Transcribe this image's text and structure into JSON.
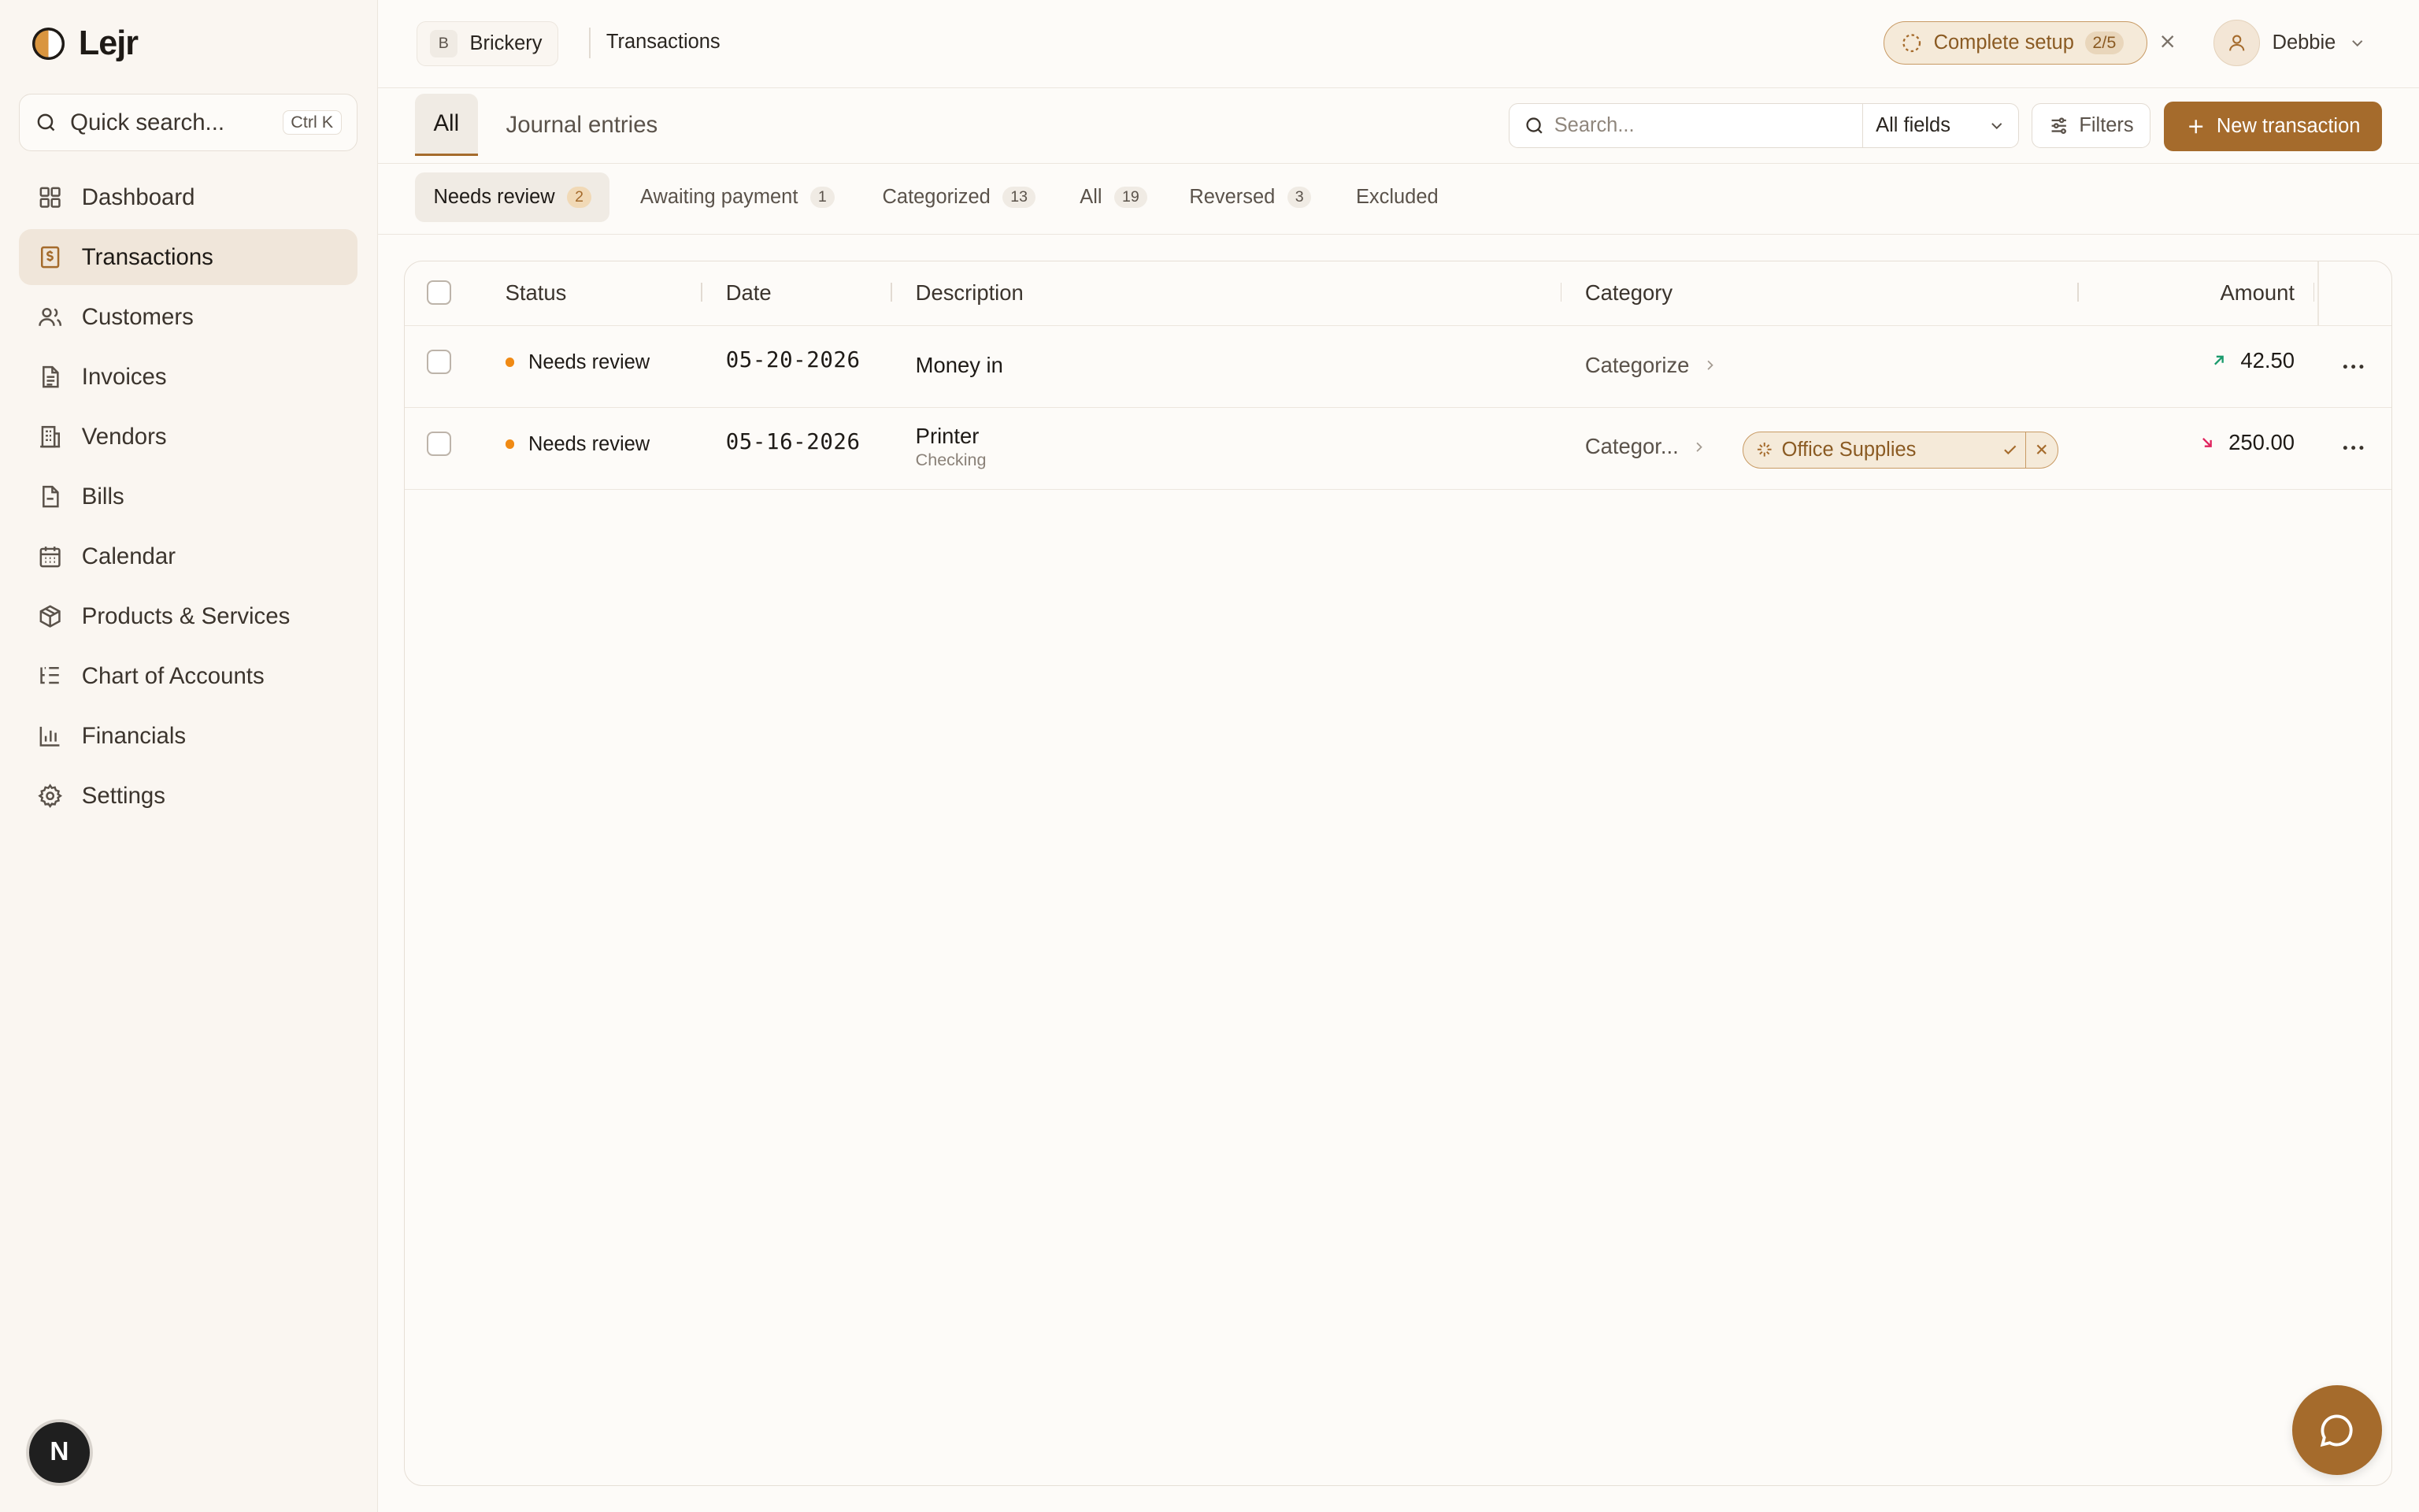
{
  "app": {
    "name": "Lejr"
  },
  "sidebar": {
    "quick_search": {
      "label": "Quick search...",
      "shortcut": "Ctrl K"
    },
    "items": [
      {
        "label": "Dashboard",
        "icon": "grid-icon",
        "active": false
      },
      {
        "label": "Transactions",
        "icon": "receipt-icon",
        "active": true
      },
      {
        "label": "Customers",
        "icon": "users-icon",
        "active": false
      },
      {
        "label": "Invoices",
        "icon": "document-icon",
        "active": false
      },
      {
        "label": "Vendors",
        "icon": "building-icon",
        "active": false
      },
      {
        "label": "Bills",
        "icon": "file-icon",
        "active": false
      },
      {
        "label": "Calendar",
        "icon": "calendar-icon",
        "active": false
      },
      {
        "label": "Products & Services",
        "icon": "box-icon",
        "active": false
      },
      {
        "label": "Chart of Accounts",
        "icon": "list-tree-icon",
        "active": false
      },
      {
        "label": "Financials",
        "icon": "bar-chart-icon",
        "active": false
      },
      {
        "label": "Settings",
        "icon": "gear-icon",
        "active": false
      }
    ],
    "footer_avatar": "N"
  },
  "header": {
    "org": {
      "letter": "B",
      "name": "Brickery"
    },
    "breadcrumb": "Transactions",
    "setup": {
      "label": "Complete setup",
      "progress": "2/5"
    },
    "user": {
      "name": "Debbie"
    }
  },
  "toolbar": {
    "tabs": [
      {
        "label": "All",
        "active": true
      },
      {
        "label": "Journal entries",
        "active": false
      }
    ],
    "search_placeholder": "Search...",
    "field_select": "All fields",
    "filters_label": "Filters",
    "new_label": "New transaction"
  },
  "subtabs": [
    {
      "label": "Needs review",
      "count": "2",
      "active": true
    },
    {
      "label": "Awaiting payment",
      "count": "1",
      "active": false
    },
    {
      "label": "Categorized",
      "count": "13",
      "active": false
    },
    {
      "label": "All",
      "count": "19",
      "active": false
    },
    {
      "label": "Reversed",
      "count": "3",
      "active": false
    },
    {
      "label": "Excluded",
      "count": "",
      "active": false
    }
  ],
  "table": {
    "columns": {
      "status": "Status",
      "date": "Date",
      "description": "Description",
      "category": "Category",
      "amount": "Amount"
    },
    "rows": [
      {
        "status": "Needs review",
        "date": "05-20-2026",
        "description": "Money in",
        "account": "",
        "category_action": "Categorize",
        "suggestion": "",
        "amount": "42.50",
        "direction": "in"
      },
      {
        "status": "Needs review",
        "date": "05-16-2026",
        "description": "Printer",
        "account": "Checking",
        "category_action": "Categor...",
        "suggestion": "Office Supplies",
        "amount": "250.00",
        "direction": "out"
      }
    ]
  },
  "colors": {
    "accent": "#a56b2c",
    "status_dot": "#f08a14",
    "money_in": "#1a9a6c",
    "money_out": "#e0245e"
  }
}
